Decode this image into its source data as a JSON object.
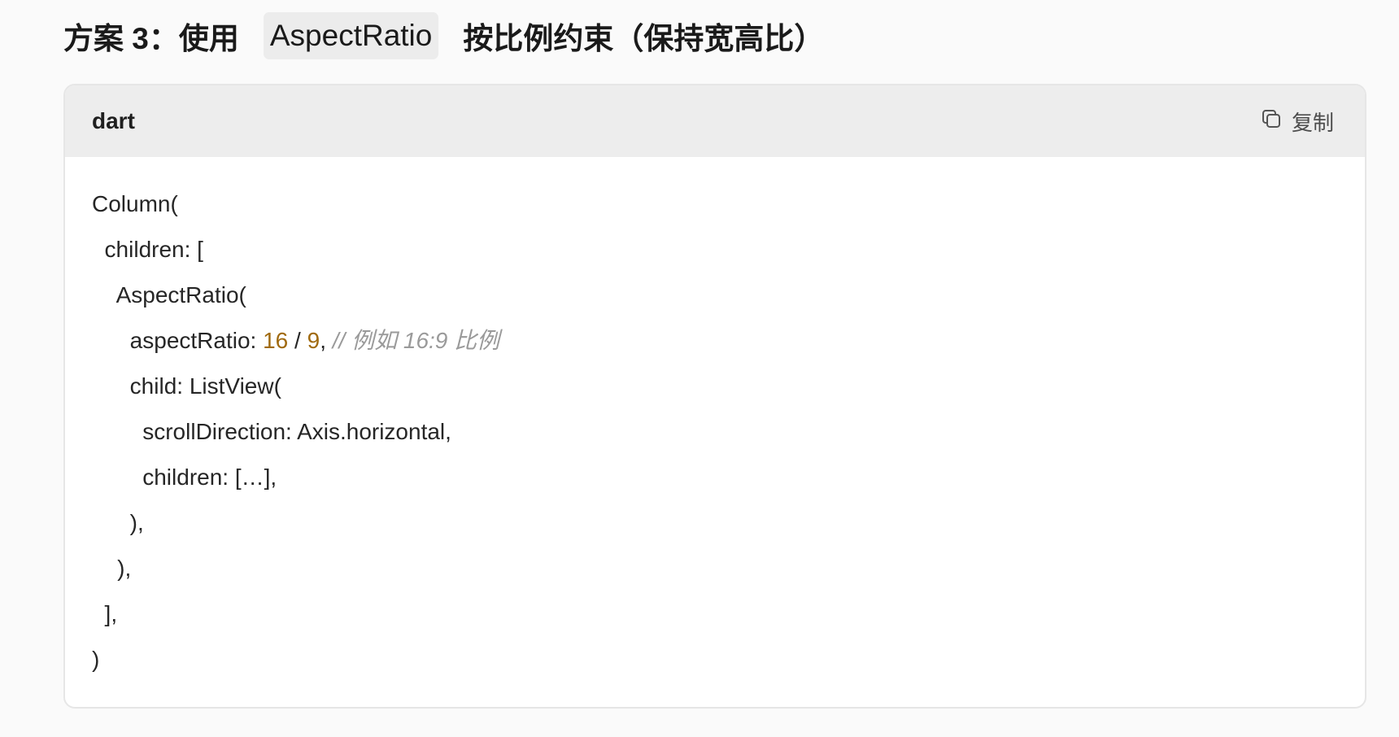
{
  "heading": {
    "prefix": "方案 3：使用",
    "code": "AspectRatio",
    "suffix": "按比例约束（保持宽高比）"
  },
  "code_block": {
    "language": "dart",
    "copy_label": "复制",
    "copy_icon": "copy-icon",
    "colors": {
      "number": "#a06a10",
      "comment": "#9a9a9a",
      "text": "#262626",
      "header_bg": "#ededed"
    },
    "lines": {
      "l1": "Column(",
      "l2": "  children: [",
      "l3": "    AspectRatio(",
      "l4_a": "      aspectRatio: ",
      "l4_num1": "16",
      "l4_b": " / ",
      "l4_num2": "9",
      "l4_c": ", ",
      "l4_comment": "// 例如 16:9 比例",
      "l5": "      child: ListView(",
      "l6": "        scrollDirection: Axis.horizontal,",
      "l7": "        children: […],",
      "l8": "      ),",
      "l9": "    ),",
      "l10": "  ],",
      "l11": ")"
    }
  }
}
